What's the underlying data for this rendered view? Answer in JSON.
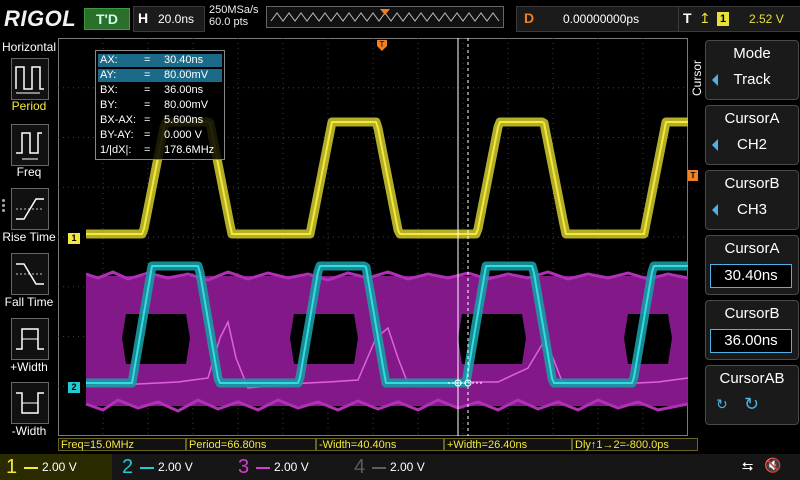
{
  "header": {
    "brand": "RIGOL",
    "trigger_status": "T'D",
    "horizontal": {
      "label": "H",
      "value": "20.0ns"
    },
    "sample_rate": "250MSa/s",
    "memory_depth": "60.0 pts",
    "delay": {
      "label": "D",
      "value": "0.00000000ps"
    },
    "trigger": {
      "label": "T",
      "channel": "1",
      "level": "2.52 V"
    }
  },
  "left_menu": {
    "title": "Horizontal",
    "items": [
      {
        "label": "Period",
        "color": "#f3e83c"
      },
      {
        "label": "Freq",
        "color": "#ffffff"
      },
      {
        "label": "Rise Time",
        "color": "#ffffff"
      },
      {
        "label": "Fall Time",
        "color": "#ffffff"
      },
      {
        "label": "+Width",
        "color": "#ffffff"
      },
      {
        "label": "-Width",
        "color": "#ffffff"
      }
    ]
  },
  "right_menu": {
    "title": "Cursor",
    "buttons": [
      {
        "title": "Mode",
        "value": "Track"
      },
      {
        "title": "CursorA",
        "value": "CH2"
      },
      {
        "title": "CursorB",
        "value": "CH3"
      },
      {
        "title": "CursorA",
        "value": "30.40ns"
      },
      {
        "title": "CursorB",
        "value": "36.00ns"
      },
      {
        "title": "CursorAB",
        "value": ""
      }
    ]
  },
  "cursor_readout": [
    {
      "name": "AX:",
      "eq": "=",
      "value": "30.40ns",
      "highlight": true
    },
    {
      "name": "AY:",
      "eq": "=",
      "value": "80.00mV",
      "highlight": true
    },
    {
      "name": "BX:",
      "eq": "=",
      "value": "36.00ns",
      "highlight": false
    },
    {
      "name": "BY:",
      "eq": "=",
      "value": "80.00mV",
      "highlight": false
    },
    {
      "name": "BX-AX:",
      "eq": "=",
      "value": "5.600ns",
      "highlight": false
    },
    {
      "name": "BY-AY:",
      "eq": "=",
      "value": "0.000 V",
      "highlight": false
    },
    {
      "name": "1/|dX|:",
      "eq": "=",
      "value": "178.6MHz",
      "highlight": false
    }
  ],
  "measurements": [
    "Freq=15.0MHz",
    "Period=66.80ns",
    "-Width=40.40ns",
    "+Width=26.40ns",
    "Dly↑1→2=-800.0ps"
  ],
  "channels": [
    {
      "num": "1",
      "scale": "2.00 V",
      "color": "#f3e83c",
      "active": true
    },
    {
      "num": "2",
      "scale": "2.00 V",
      "color": "#22c8d2",
      "active": false
    },
    {
      "num": "3",
      "scale": "2.00 V",
      "color": "#d040d0",
      "active": false
    },
    {
      "num": "4",
      "scale": "2.00 V",
      "color": "#5d5d5d",
      "active": false
    }
  ],
  "markers": {
    "ch1": "1",
    "ch2": "2",
    "trigger": "T"
  },
  "colors": {
    "ch1": "#f3e83c",
    "ch2": "#22c8d2",
    "ch3": "#d040d0",
    "trigger": "#f08020",
    "accent": "#4fb1e6"
  }
}
